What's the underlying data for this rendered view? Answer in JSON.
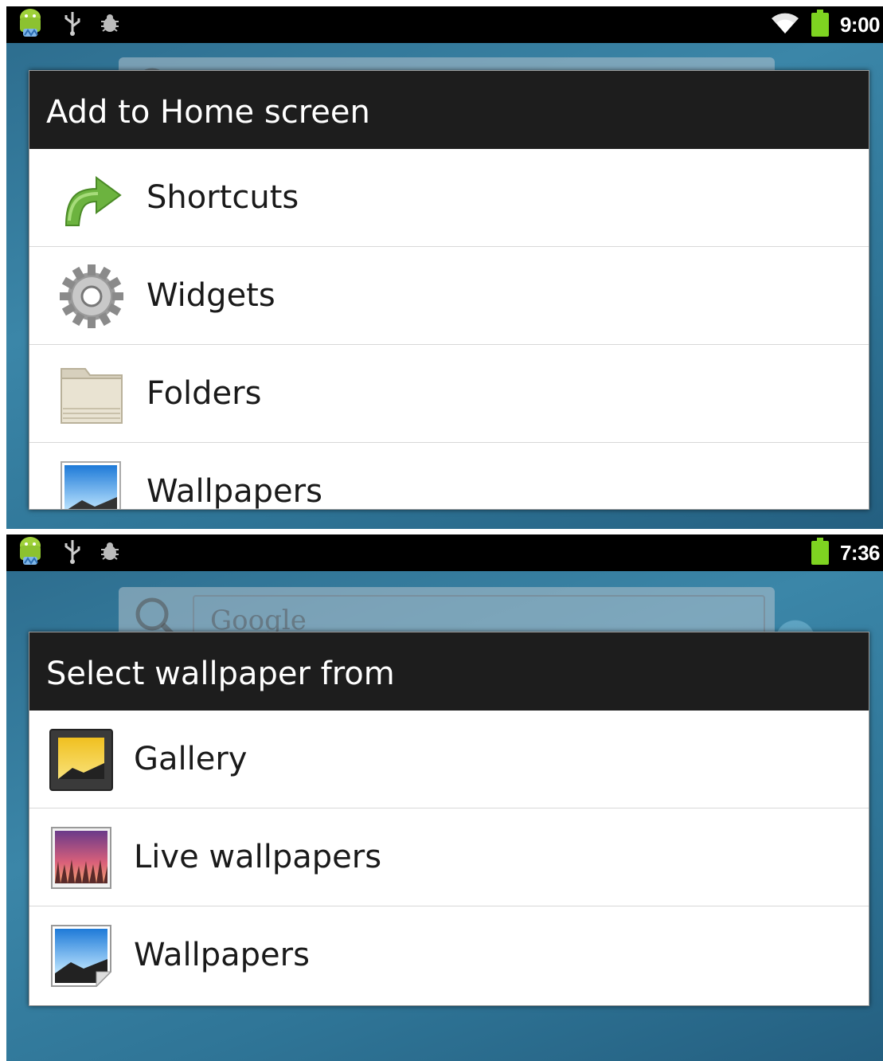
{
  "top_screen": {
    "status_bar": {
      "notification_icons": [
        "android-debug-icon",
        "usb-icon",
        "bug-icon"
      ],
      "system_icons": [
        "wifi-icon",
        "battery-icon"
      ],
      "time": "9:00"
    },
    "dialog": {
      "title": "Add to Home screen",
      "items": [
        {
          "label": "Shortcuts",
          "icon": "shortcut-arrow-icon"
        },
        {
          "label": "Widgets",
          "icon": "gear-icon"
        },
        {
          "label": "Folders",
          "icon": "folder-icon"
        },
        {
          "label": "Wallpapers",
          "icon": "wallpaper-icon"
        }
      ]
    }
  },
  "bottom_screen": {
    "status_bar": {
      "notification_icons": [
        "android-debug-icon",
        "usb-icon",
        "bug-icon"
      ],
      "system_icons": [
        "battery-icon"
      ],
      "time": "7:36"
    },
    "search_widget": {
      "placeholder": "Google"
    },
    "dialog": {
      "title": "Select wallpaper from",
      "items": [
        {
          "label": "Gallery",
          "icon": "gallery-icon"
        },
        {
          "label": "Live wallpapers",
          "icon": "live-wallpaper-icon"
        },
        {
          "label": "Wallpapers",
          "icon": "wallpaper-icon"
        }
      ]
    }
  },
  "colors": {
    "status_bar": "#000000",
    "dialog_title_bg": "#0c0c0c",
    "dialog_bg": "#ffffff",
    "battery": "#7ed321",
    "shortcut_arrow": "#6cb33f"
  }
}
